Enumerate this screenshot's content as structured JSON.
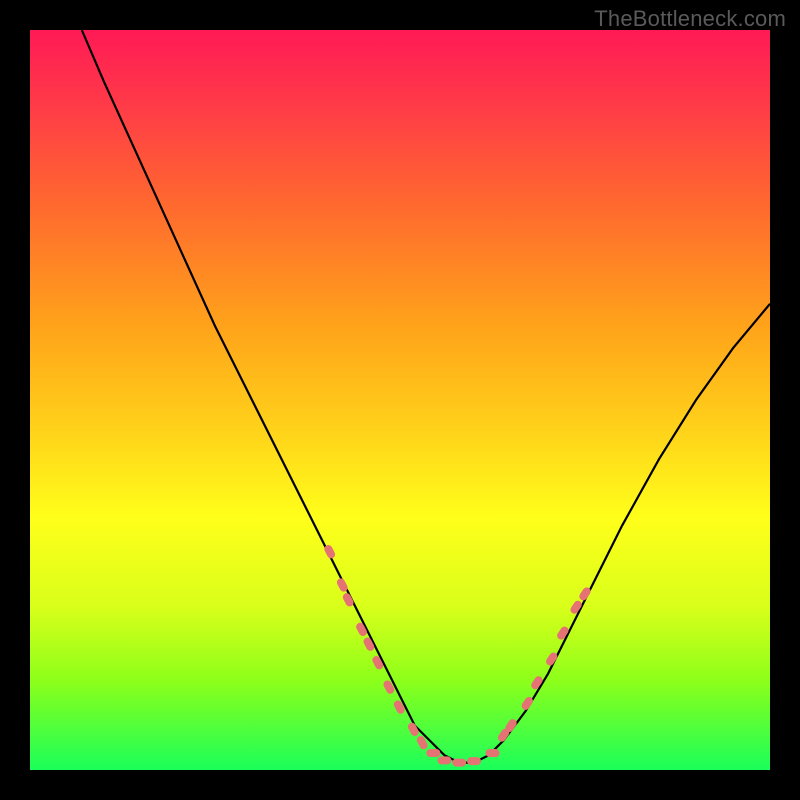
{
  "watermark": "TheBottleneck.com",
  "colors": {
    "frame": "#000000",
    "curve": "#000000",
    "dot_fill": "#e57373",
    "gradient_top": "#ff1a55",
    "gradient_bottom": "#1aff5a"
  },
  "chart_data": {
    "type": "line",
    "title": "",
    "xlabel": "",
    "ylabel": "",
    "xlim": [
      0,
      100
    ],
    "ylim": [
      0,
      100
    ],
    "grid": false,
    "legend": false,
    "series": [
      {
        "name": "curve",
        "x": [
          7,
          10,
          15,
          20,
          25,
          30,
          35,
          40,
          45,
          48,
          50,
          52,
          54,
          56,
          58,
          60,
          62,
          64,
          67,
          70,
          75,
          80,
          85,
          90,
          95,
          100
        ],
        "y": [
          100,
          93,
          82,
          71,
          60,
          50,
          40,
          30,
          20,
          14,
          10,
          6,
          4,
          2,
          1,
          1,
          2,
          4,
          8,
          13,
          23,
          33,
          42,
          50,
          57,
          63
        ]
      }
    ],
    "annotations": {
      "dots_left": {
        "x": [
          40.5,
          42.2,
          43.0,
          44.8,
          45.8,
          47.0,
          48.5,
          49.9,
          51.8,
          53.0
        ],
        "y": [
          29.5,
          25.0,
          23.0,
          19.0,
          17.0,
          14.5,
          11.2,
          8.5,
          5.5,
          3.7
        ]
      },
      "dots_bottom": {
        "x": [
          54.5,
          56.0,
          58.0,
          60.0,
          62.5
        ],
        "y": [
          2.3,
          1.3,
          1.0,
          1.2,
          2.3
        ]
      },
      "dots_right": {
        "x": [
          64.0,
          65.0,
          67.2,
          68.5,
          70.5,
          72.0,
          73.8,
          75.0
        ],
        "y": [
          4.7,
          6.0,
          9.0,
          11.8,
          15.0,
          18.5,
          22.0,
          23.8
        ]
      }
    }
  }
}
